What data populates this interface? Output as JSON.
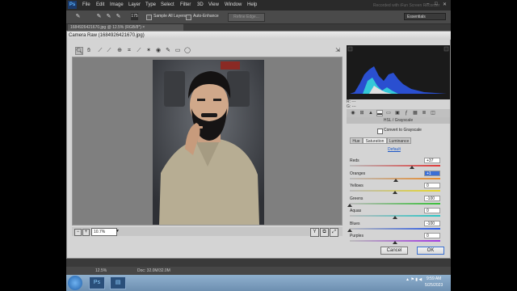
{
  "app": {
    "logo": "Ps",
    "menu": [
      "File",
      "Edit",
      "Image",
      "Layer",
      "Type",
      "Select",
      "Filter",
      "3D",
      "View",
      "Window",
      "Help"
    ],
    "recorder_text": "Recorded with iFun Screen Recorder",
    "window_controls": [
      "–",
      "□",
      "✕"
    ]
  },
  "options_bar": {
    "tools": [
      "✎",
      "✎",
      "✎",
      "✎",
      "◐"
    ],
    "brush_size": "175",
    "sample_all_layers": "Sample All Layers",
    "auto_enhance": "Auto-Enhance",
    "refine_edge": "Refine Edge...",
    "workspace": "Essentials"
  },
  "document_tab": "1684926421670.jpg @ 12.5% (RGB/8*) ×",
  "camera_raw": {
    "title": "Camera Raw (1684926421670.jpg)",
    "tools": [
      "zoom-icon",
      "hand-icon",
      "white-balance-icon",
      "color-sampler-icon",
      "target-adjust-icon",
      "crop-icon",
      "straighten-icon",
      "spot-removal-icon",
      "red-eye-icon",
      "adjustment-brush-icon",
      "graduated-filter-icon",
      "radial-filter-icon"
    ],
    "zoom": "10.7%",
    "rgb": {
      "r": "R:  ---",
      "g": "G:  ---",
      "b": "B:  ---"
    },
    "panel_title": "HSL / Grayscale",
    "convert_to_grayscale": "Convert to Grayscale",
    "subtabs": [
      "Hue",
      "Saturation",
      "Luminance"
    ],
    "default": "Default",
    "sliders": [
      {
        "label": "Reds",
        "value": "+37",
        "level": 0.685,
        "active": false
      },
      {
        "label": "Oranges",
        "value": "+1",
        "level": 0.505,
        "active": true
      },
      {
        "label": "Yellows",
        "value": "0",
        "level": 0.5,
        "active": false
      },
      {
        "label": "Greens",
        "value": "-100",
        "level": 0.0,
        "active": false
      },
      {
        "label": "Aquas",
        "value": "0",
        "level": 0.5,
        "active": false
      },
      {
        "label": "Blues",
        "value": "-100",
        "level": 0.0,
        "active": false
      },
      {
        "label": "Purples",
        "value": "0",
        "level": 0.5,
        "active": false
      }
    ],
    "cancel": "Cancel",
    "ok": "OK"
  },
  "status_bar": {
    "zoom": "12.5%",
    "doc": "Doc: 32.0M/32.0M"
  },
  "taskbar": {
    "time": "9:59 AM",
    "date": "5/25/2023",
    "apps": [
      "Ps",
      "▤"
    ]
  },
  "colors": {
    "accent": "#3b6fd6",
    "ps_blue": "#59b3ff"
  }
}
